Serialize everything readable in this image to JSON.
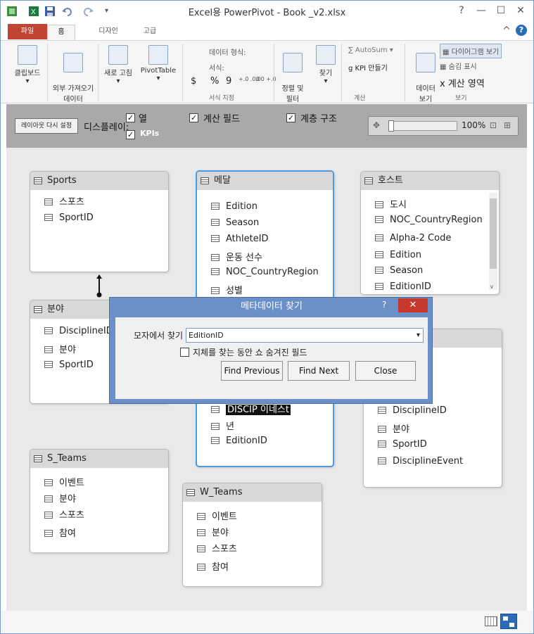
{
  "window": {
    "title": "Excel용 PowerPivot - Book      _v2.xlsx",
    "controls": {
      "help": "?",
      "min": "—",
      "max": "☐",
      "close": "✕",
      "collapse": "^"
    }
  },
  "tabs": [
    {
      "label": "파일"
    },
    {
      "label": "홈"
    },
    {
      "label": "디자인"
    },
    {
      "label": "고급"
    }
  ],
  "ribbon": {
    "clipboard": "클립보드",
    "get_external": "외부 가져오기\n데이터",
    "refresh": "새로 고침",
    "pivot": "PivotTable",
    "data_type": "데이터 형식:",
    "format": "서식:",
    "currency": "$",
    "percent": "%",
    "comma": "9",
    "dec_inc": "+.0 .00",
    "dec_dec": ".00 +.0",
    "format_group": "서식 지정",
    "sort_filter": "정렬 및\n필터",
    "find": "찾기",
    "autosum": "AutoSum",
    "create_kpi": "KPI 만들기",
    "calc_group": "계산",
    "data_view": "데이터\n보기",
    "diagram_view": "다이어그램 보기",
    "show_hidden": "숨김 표시",
    "calc_area": "계산 영역",
    "view_group": "보기"
  },
  "options": {
    "reset_layout": "레이아웃 다시 설정",
    "display_label": "디스플레이:",
    "columns": "열",
    "calc_fields": "계산 필드",
    "hierarchies": "계층 구조",
    "kpis": "KPIs",
    "zoom": "100%"
  },
  "tables": {
    "sports": {
      "title": "Sports",
      "rows": [
        "스포츠",
        "SportID"
      ]
    },
    "medals": {
      "title": "메달",
      "rows": [
        "Edition",
        "Season",
        "AthleteID",
        "운동 선수",
        "NOC_CountryRegion",
        "성별",
        "DISCIP 이네스t",
        "년",
        "EditionID"
      ]
    },
    "hosts": {
      "title": "호스트",
      "rows": [
        "도시",
        "NOC_CountryRegion",
        "Alpha-2 Code",
        "Edition",
        "Season",
        "EditionID"
      ]
    },
    "discipline": {
      "title": "분야",
      "rows": [
        "DisciplineID",
        "분야",
        "SportID"
      ]
    },
    "events": {
      "rows": [
        "DisciplineID",
        "분야",
        "SportID",
        "DisciplineEvent"
      ]
    },
    "s_teams": {
      "title": "S_Teams",
      "rows": [
        "이벤트",
        "분야",
        "스포츠",
        "참여"
      ]
    },
    "w_teams": {
      "title": "W_Teams",
      "rows": [
        "이벤트",
        "분야",
        "스포츠",
        "참여"
      ]
    }
  },
  "dialog": {
    "title": "메타데이터 찾기",
    "help": "?",
    "close": "✕",
    "find_in_label": "모자에서 찾기",
    "find_value": "EditionID",
    "checkbox_label": "지체를 찾는 동안 쇼 숨겨진 필드",
    "find_previous": "Find Previous",
    "find_next": "Find Next",
    "close_label": "Close"
  },
  "colors": {
    "file_tab": "#c14333",
    "dialog": "#6b8fc7",
    "selected_table_border": "#4a9be0"
  }
}
